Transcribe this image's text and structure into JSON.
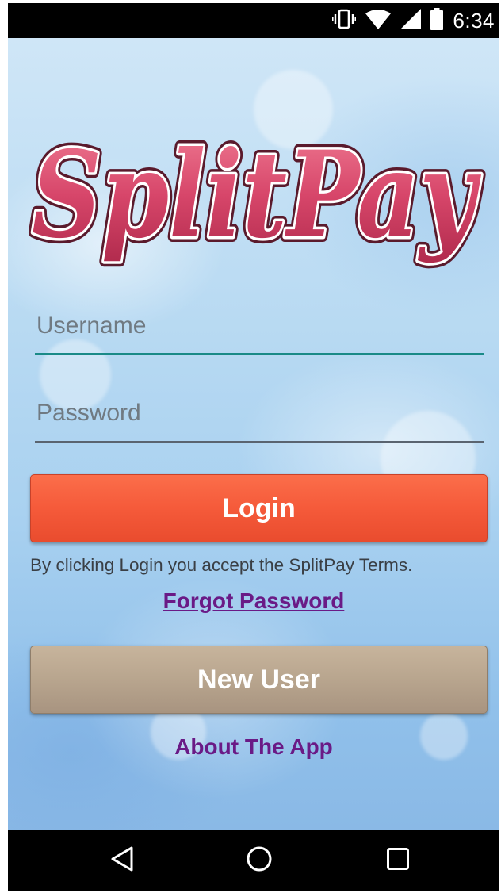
{
  "status_bar": {
    "time": "6:34",
    "icons": [
      "vibrate-icon",
      "wifi-icon",
      "signal-icon",
      "battery-icon"
    ]
  },
  "logo": {
    "text": "SplitPay",
    "fill_color": "#d7466a",
    "stroke_color": "#5a1a2c"
  },
  "form": {
    "username_placeholder": "Username",
    "username_value": "",
    "password_placeholder": "Password",
    "password_value": ""
  },
  "buttons": {
    "login_label": "Login",
    "new_user_label": "New User"
  },
  "terms_text": "By clicking Login you accept the SplitPay Terms.",
  "links": {
    "forgot_password": "Forgot Password",
    "about_app": "About The App"
  },
  "colors": {
    "login_button": "#f55a3a",
    "new_user_button": "#b8a58e",
    "link": "#6a1a86",
    "focused_underline": "#1a8a87"
  },
  "nav_bar": {
    "icons": [
      "back-icon",
      "home-icon",
      "recents-icon"
    ]
  }
}
